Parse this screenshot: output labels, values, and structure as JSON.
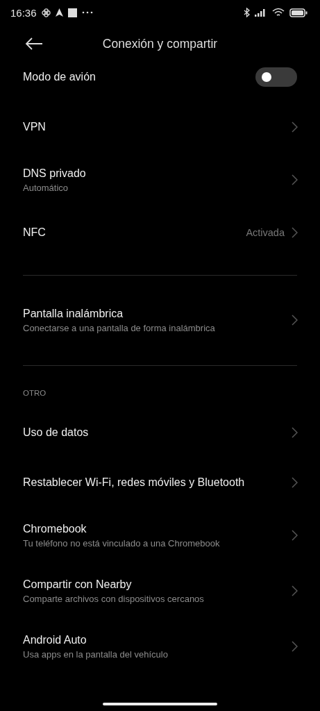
{
  "status_bar": {
    "time": "16:36"
  },
  "header": {
    "title": "Conexión y compartir"
  },
  "sections": [
    {
      "items": [
        {
          "kind": "toggle",
          "title": "Modo de avión",
          "on": false
        },
        {
          "kind": "link",
          "title": "VPN"
        },
        {
          "kind": "link",
          "title": "DNS privado",
          "subtitle": "Automático"
        },
        {
          "kind": "link",
          "title": "NFC",
          "value": "Activada"
        }
      ]
    },
    {
      "items": [
        {
          "kind": "link",
          "title": "Pantalla inalámbrica",
          "subtitle": "Conectarse a una pantalla de forma inalámbrica"
        }
      ]
    },
    {
      "title": "OTRO",
      "items": [
        {
          "kind": "link",
          "title": "Uso de datos"
        },
        {
          "kind": "link",
          "title": "Restablecer Wi-Fi, redes móviles y Bluetooth"
        },
        {
          "kind": "link",
          "title": "Chromebook",
          "subtitle": "Tu teléfono no está vinculado a una Chromebook"
        },
        {
          "kind": "link",
          "title": "Compartir con Nearby",
          "subtitle": "Comparte archivos con dispositivos cercanos"
        },
        {
          "kind": "link",
          "title": "Android Auto",
          "subtitle": "Usa apps en la pantalla del vehículo"
        }
      ]
    }
  ]
}
